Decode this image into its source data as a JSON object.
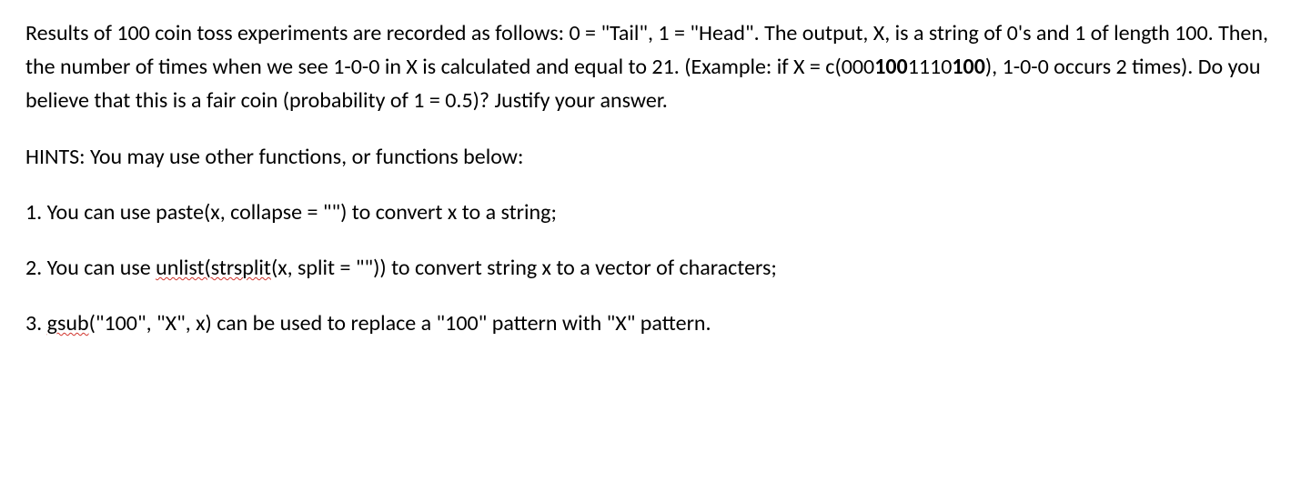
{
  "paragraph": {
    "seg1": "Results of 100 coin toss experiments are recorded as follows: 0 = \"Tail\", 1 = \"Head\". The output, X, is a string of 0's and 1 of length 100. Then, the number of times when we see 1-0-0 in X is calculated and equal to 21.  (Example: if X = c(",
    "seq_a": "000",
    "seq_b": "100",
    "seq_c": "1110",
    "seq_d": "100",
    "seg2": "), 1-0-0 occurs 2 times).  Do you believe that this is a fair coin (probability of 1 = 0.5)? Justify your answer."
  },
  "hints_label": "HINTS: You may use other functions, or functions below:",
  "hints": {
    "one": "1. You can use paste(x, collapse = \"\") to convert x to a string;",
    "two_a": "2. You can use ",
    "two_b": "unlist(strsplit",
    "two_c": "(x, split = \"\")) to convert string x to a vector of characters;",
    "three_a": "3. ",
    "three_b": "gsub",
    "three_c": "(\"100\", \"X\", x) can be used to replace a \"100\" pattern with \"X\" pattern."
  }
}
